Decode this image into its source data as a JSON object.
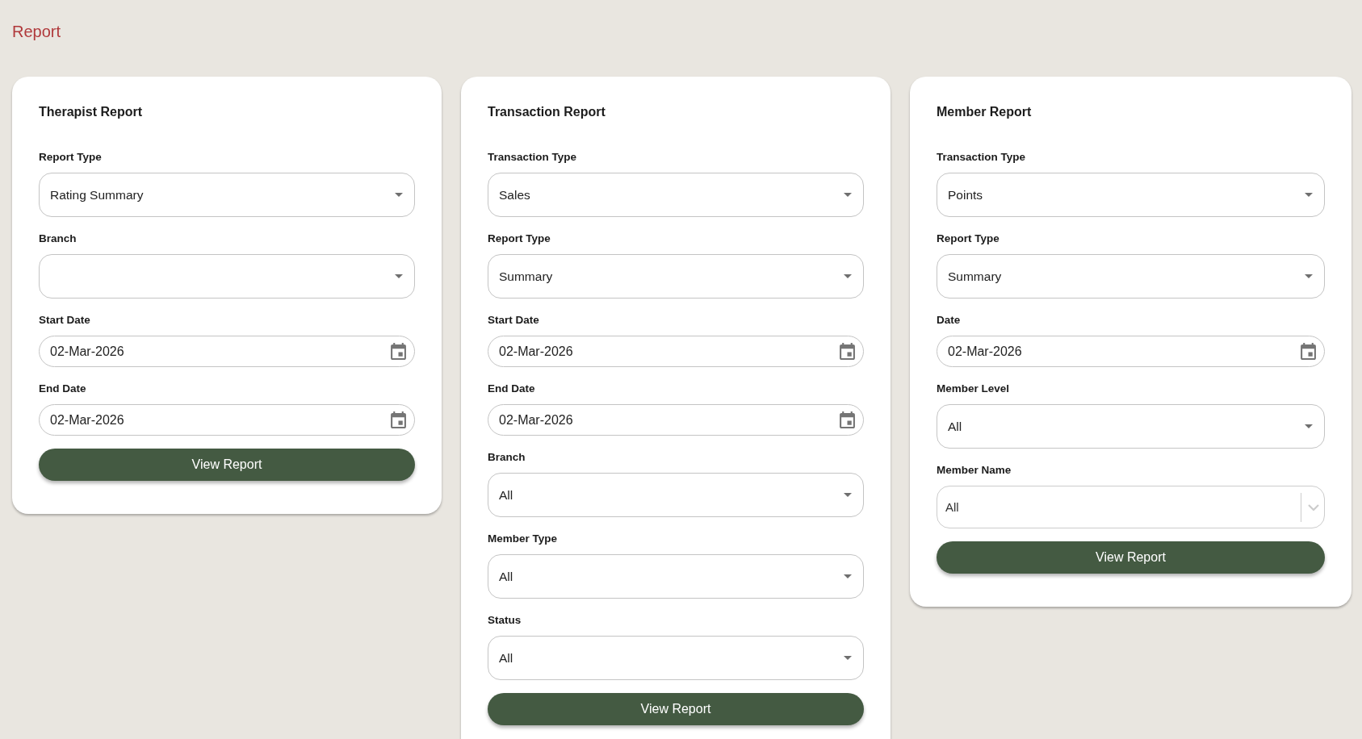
{
  "page_title": "Report",
  "cards": [
    {
      "title": "Therapist Report",
      "fields": [
        {
          "kind": "select",
          "label": "Report Type",
          "value": "Rating Summary"
        },
        {
          "kind": "select",
          "label": "Branch"
        },
        {
          "kind": "date",
          "label": "Start Date",
          "value": "02-Mar-2026"
        },
        {
          "kind": "date",
          "label": "End Date",
          "value": "02-Mar-2026"
        }
      ],
      "button": "View Report"
    },
    {
      "title": "Transaction Report",
      "fields": [
        {
          "kind": "select",
          "label": "Transaction Type",
          "value": "Sales"
        },
        {
          "kind": "select",
          "label": "Report Type",
          "value": "Summary"
        },
        {
          "kind": "date",
          "label": "Start Date",
          "value": "02-Mar-2026"
        },
        {
          "kind": "date",
          "label": "End Date",
          "value": "02-Mar-2026"
        },
        {
          "kind": "select",
          "label": "Branch",
          "value": "All"
        },
        {
          "kind": "select",
          "label": "Member Type",
          "value": "All"
        },
        {
          "kind": "select",
          "label": "Status",
          "value": "All"
        }
      ],
      "button": "View Report"
    },
    {
      "title": "Member Report",
      "fields": [
        {
          "kind": "select",
          "label": "Transaction Type",
          "value": "Points"
        },
        {
          "kind": "select",
          "label": "Report Type",
          "value": "Summary"
        },
        {
          "kind": "date",
          "label": "Date",
          "value": "02-Mar-2026"
        },
        {
          "kind": "select",
          "label": "Member Level",
          "value": "All"
        },
        {
          "kind": "combobox",
          "label": "Member Name",
          "value": "All"
        }
      ],
      "button": "View Report"
    }
  ]
}
